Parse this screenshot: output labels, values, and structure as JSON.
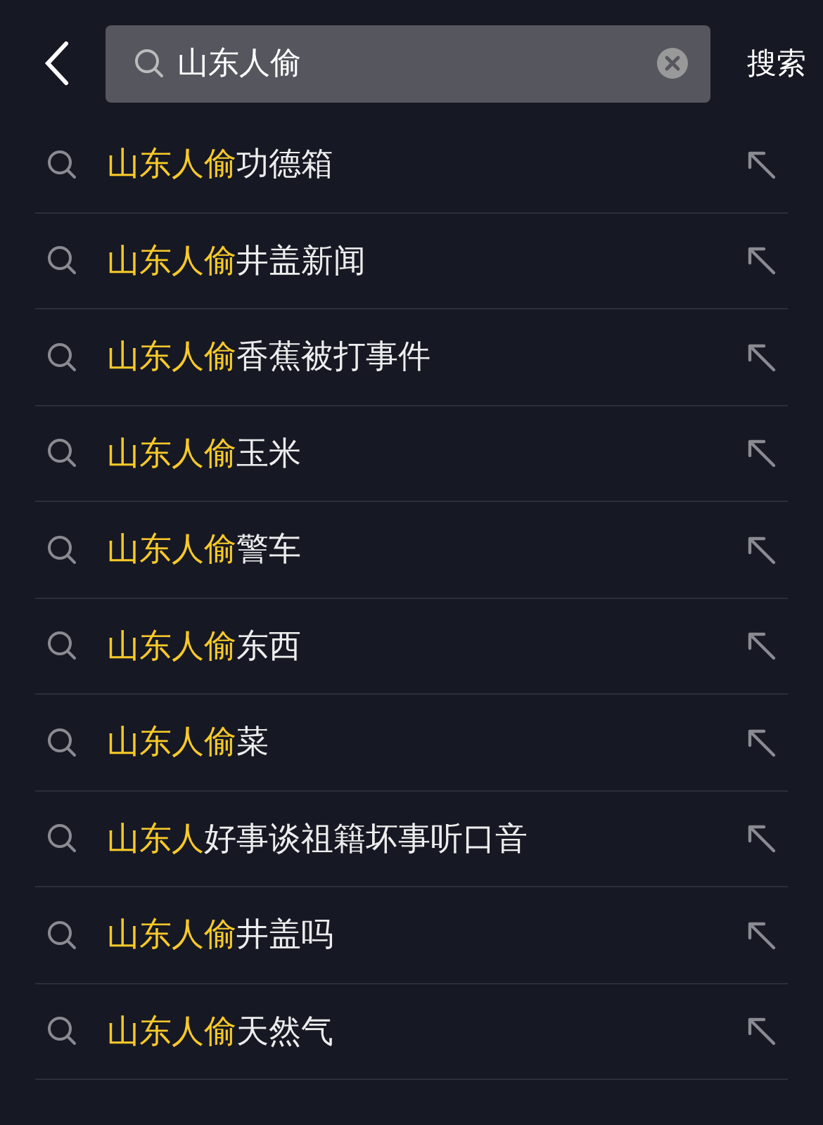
{
  "search": {
    "value": "山东人偷",
    "button": "搜索"
  },
  "suggestions": [
    {
      "match": "山东人偷",
      "rest": "功德箱"
    },
    {
      "match": "山东人偷",
      "rest": "井盖新闻"
    },
    {
      "match": "山东人偷",
      "rest": "香蕉被打事件"
    },
    {
      "match": "山东人偷",
      "rest": "玉米"
    },
    {
      "match": "山东人偷",
      "rest": "警车"
    },
    {
      "match": "山东人偷",
      "rest": "东西"
    },
    {
      "match": "山东人偷",
      "rest": "菜"
    },
    {
      "match": "山东人",
      "rest": "好事谈祖籍坏事听口音"
    },
    {
      "match": "山东人偷",
      "rest": "井盖吗"
    },
    {
      "match": "山东人偷",
      "rest": "天然气"
    }
  ]
}
